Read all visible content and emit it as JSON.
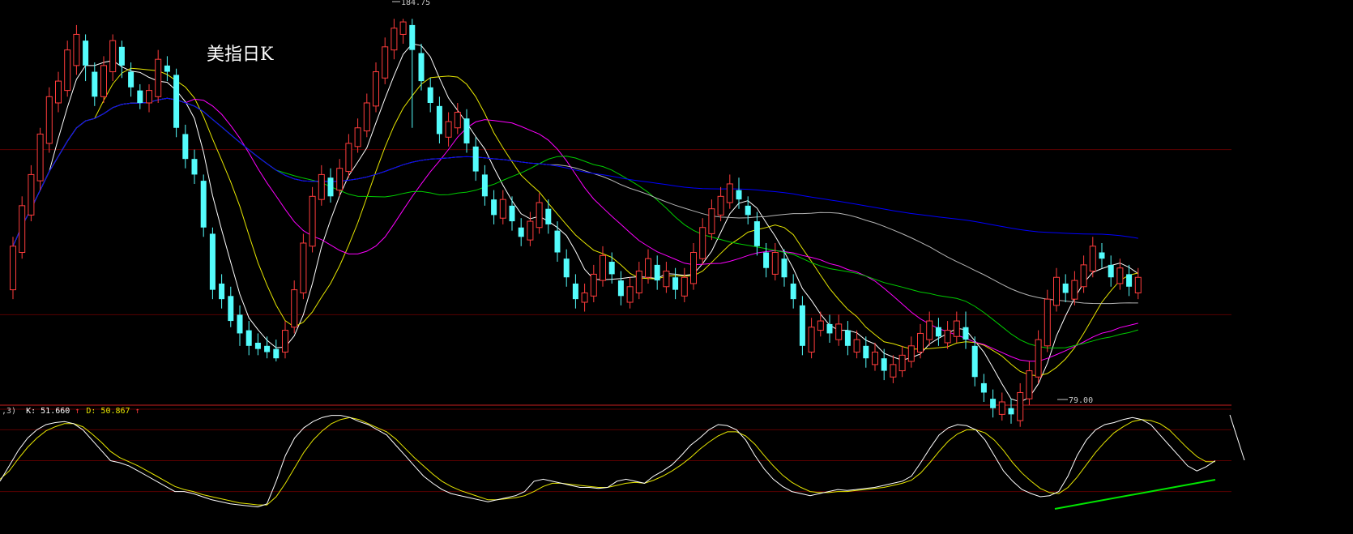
{
  "chart_data": [
    {
      "type": "candlestick",
      "title": "美指日K",
      "high_label": "184.75",
      "low_label": "79.00",
      "y_range": [
        62,
        190
      ],
      "bull_color": "#ff3c3c",
      "bear_color": "#54fcfc",
      "grid_values": [
        143,
        90
      ],
      "candles": [
        [
          98,
          112,
          95,
          115
        ],
        [
          110,
          125,
          108,
          128
        ],
        [
          122,
          135,
          120,
          138
        ],
        [
          133,
          148,
          130,
          150
        ],
        [
          145,
          160,
          142,
          163
        ],
        [
          158,
          165,
          155,
          168
        ],
        [
          162,
          175,
          160,
          178
        ],
        [
          170,
          180,
          167,
          183
        ],
        [
          178,
          170,
          165,
          180
        ],
        [
          168,
          160,
          157,
          171
        ],
        [
          160,
          170,
          158,
          173
        ],
        [
          168,
          178,
          165,
          180
        ],
        [
          176,
          170,
          166,
          178
        ],
        [
          168,
          163,
          160,
          171
        ],
        [
          162,
          158,
          156,
          164
        ],
        [
          158,
          162,
          155,
          164
        ],
        [
          160,
          172,
          158,
          175
        ],
        [
          170,
          168,
          165,
          173
        ],
        [
          167,
          150,
          147,
          169
        ],
        [
          148,
          140,
          137,
          151
        ],
        [
          140,
          135,
          132,
          143
        ],
        [
          133,
          118,
          115,
          135
        ],
        [
          116,
          98,
          95,
          118
        ],
        [
          100,
          95,
          92,
          103
        ],
        [
          96,
          88,
          86,
          99
        ],
        [
          90,
          84,
          80,
          93
        ],
        [
          85,
          80,
          77,
          88
        ],
        [
          81,
          79,
          77,
          84
        ],
        [
          80,
          78,
          76,
          83
        ],
        [
          79,
          76,
          75,
          82
        ],
        [
          78,
          85,
          76,
          88
        ],
        [
          86,
          98,
          84,
          101
        ],
        [
          97,
          113,
          95,
          116
        ],
        [
          112,
          128,
          110,
          131
        ],
        [
          127,
          135,
          125,
          138
        ],
        [
          134,
          128,
          126,
          137
        ],
        [
          130,
          137,
          128,
          140
        ],
        [
          136,
          145,
          134,
          148
        ],
        [
          144,
          150,
          142,
          153
        ],
        [
          149,
          158,
          147,
          161
        ],
        [
          157,
          168,
          155,
          171
        ],
        [
          166,
          176,
          164,
          179
        ],
        [
          175,
          182,
          172,
          185
        ],
        [
          180,
          184,
          177,
          185
        ],
        [
          183,
          175,
          150,
          185
        ],
        [
          174,
          165,
          162,
          177
        ],
        [
          163,
          158,
          155,
          166
        ],
        [
          157,
          148,
          145,
          160
        ],
        [
          147,
          152,
          144,
          155
        ],
        [
          150,
          155,
          148,
          158
        ],
        [
          153,
          145,
          142,
          156
        ],
        [
          144,
          136,
          133,
          147
        ],
        [
          135,
          128,
          125,
          138
        ],
        [
          127,
          122,
          119,
          130
        ],
        [
          121,
          127,
          119,
          130
        ],
        [
          125,
          120,
          117,
          128
        ],
        [
          118,
          115,
          112,
          121
        ],
        [
          114,
          120,
          112,
          123
        ],
        [
          118,
          126,
          116,
          129
        ],
        [
          124,
          119,
          116,
          127
        ],
        [
          117,
          110,
          107,
          120
        ],
        [
          108,
          102,
          99,
          111
        ],
        [
          100,
          95,
          92,
          103
        ],
        [
          94,
          97,
          91,
          100
        ],
        [
          96,
          103,
          94,
          106
        ],
        [
          101,
          109,
          99,
          112
        ],
        [
          107,
          103,
          100,
          110
        ],
        [
          101,
          96,
          93,
          104
        ],
        [
          94,
          99,
          92,
          102
        ],
        [
          97,
          104,
          95,
          107
        ],
        [
          102,
          108,
          100,
          111
        ],
        [
          106,
          101,
          98,
          109
        ],
        [
          99,
          104,
          97,
          107
        ],
        [
          102,
          98,
          95,
          105
        ],
        [
          96,
          102,
          94,
          105
        ],
        [
          100,
          110,
          98,
          113
        ],
        [
          108,
          118,
          106,
          121
        ],
        [
          116,
          124,
          114,
          127
        ],
        [
          122,
          128,
          120,
          131
        ],
        [
          126,
          132,
          124,
          135
        ],
        [
          130,
          127,
          124,
          134
        ],
        [
          125,
          122,
          119,
          128
        ],
        [
          120,
          112,
          109,
          123
        ],
        [
          110,
          105,
          102,
          113
        ],
        [
          103,
          110,
          101,
          113
        ],
        [
          108,
          102,
          99,
          111
        ],
        [
          100,
          95,
          92,
          103
        ],
        [
          93,
          80,
          77,
          96
        ],
        [
          78,
          86,
          76,
          89
        ],
        [
          85,
          88,
          83,
          91
        ],
        [
          87,
          84,
          81,
          90
        ],
        [
          82,
          87,
          80,
          90
        ],
        [
          85,
          80,
          77,
          88
        ],
        [
          78,
          82,
          76,
          85
        ],
        [
          80,
          76,
          73,
          83
        ],
        [
          74,
          78,
          72,
          81
        ],
        [
          76,
          72,
          69,
          79
        ],
        [
          70,
          74,
          68,
          77
        ],
        [
          72,
          77,
          70,
          80
        ],
        [
          75,
          80,
          73,
          83
        ],
        [
          78,
          84,
          76,
          87
        ],
        [
          82,
          88,
          80,
          91
        ],
        [
          86,
          83,
          80,
          89
        ],
        [
          81,
          85,
          79,
          88
        ],
        [
          83,
          88,
          81,
          91
        ],
        [
          86,
          82,
          79,
          91
        ],
        [
          80,
          70,
          67,
          83
        ],
        [
          68,
          65,
          62,
          71
        ],
        [
          63,
          60,
          57,
          66
        ],
        [
          58,
          62,
          56,
          65
        ],
        [
          60,
          58,
          55,
          63
        ],
        [
          56,
          65,
          54,
          68
        ],
        [
          63,
          72,
          61,
          75
        ],
        [
          70,
          82,
          68,
          85
        ],
        [
          80,
          95,
          78,
          98
        ],
        [
          93,
          102,
          91,
          105
        ],
        [
          100,
          97,
          94,
          103
        ],
        [
          95,
          101,
          93,
          104
        ],
        [
          99,
          106,
          97,
          109
        ],
        [
          104,
          112,
          102,
          115
        ],
        [
          110,
          108,
          105,
          113
        ],
        [
          106,
          102,
          99,
          109
        ],
        [
          100,
          105,
          98,
          108
        ],
        [
          103,
          99,
          96,
          106
        ],
        [
          97,
          102,
          95,
          105
        ]
      ],
      "ma_colors": [
        "#ffffff",
        "#e6e600",
        "#ff00ff",
        "#00cc00",
        "#b4b4b4",
        "#0000ff"
      ],
      "ma_periods": [
        5,
        10,
        20,
        30,
        60,
        120
      ]
    },
    {
      "type": "line",
      "label_prefix": ",3)",
      "k_label": "K: 51.660",
      "d_label": "D: 50.867",
      "k_arrow": "↑",
      "d_arrow": "↑",
      "k_color": "#ffffff",
      "d_color": "#e6e600",
      "y_range": [
        0,
        100
      ],
      "grid_values": [
        100,
        80,
        50,
        20
      ],
      "k": [
        30,
        45,
        60,
        72,
        80,
        85,
        87,
        88,
        86,
        80,
        70,
        60,
        50,
        48,
        45,
        40,
        35,
        30,
        25,
        20,
        20,
        18,
        15,
        12,
        10,
        8,
        7,
        6,
        5,
        8,
        30,
        55,
        72,
        82,
        88,
        92,
        94,
        94,
        92,
        88,
        85,
        80,
        75,
        65,
        55,
        45,
        35,
        28,
        22,
        18,
        16,
        14,
        12,
        10,
        12,
        14,
        16,
        20,
        30,
        32,
        30,
        28,
        26,
        24,
        24,
        23,
        24,
        30,
        32,
        30,
        28,
        35,
        40,
        46,
        55,
        65,
        72,
        80,
        85,
        84,
        80,
        70,
        55,
        42,
        32,
        25,
        20,
        18,
        16,
        18,
        20,
        22,
        21,
        22,
        23,
        24,
        26,
        28,
        30,
        35,
        48,
        62,
        75,
        82,
        85,
        84,
        80,
        70,
        55,
        40,
        30,
        22,
        18,
        15,
        16,
        20,
        35,
        55,
        70,
        80,
        85,
        87,
        90,
        92,
        90,
        85,
        75,
        65,
        55,
        45,
        40,
        44,
        50
      ],
      "d": [
        32,
        40,
        52,
        63,
        72,
        79,
        83,
        86,
        86,
        83,
        76,
        68,
        59,
        53,
        49,
        45,
        40,
        35,
        30,
        25,
        22,
        20,
        17,
        15,
        13,
        11,
        9,
        8,
        7,
        7,
        15,
        28,
        43,
        58,
        70,
        79,
        86,
        90,
        92,
        90,
        86,
        82,
        78,
        71,
        62,
        53,
        45,
        37,
        30,
        25,
        21,
        18,
        15,
        12,
        12,
        13,
        14,
        16,
        20,
        25,
        28,
        28,
        27,
        26,
        25,
        24,
        24,
        26,
        28,
        29,
        28,
        31,
        35,
        40,
        46,
        53,
        61,
        68,
        74,
        78,
        78,
        74,
        66,
        55,
        45,
        36,
        29,
        24,
        20,
        19,
        19,
        20,
        20,
        21,
        22,
        23,
        24,
        26,
        28,
        31,
        38,
        48,
        59,
        69,
        76,
        80,
        80,
        77,
        70,
        60,
        48,
        38,
        30,
        23,
        19,
        18,
        24,
        34,
        46,
        58,
        68,
        77,
        83,
        88,
        90,
        89,
        86,
        80,
        71,
        62,
        54,
        49,
        49
      ]
    }
  ]
}
